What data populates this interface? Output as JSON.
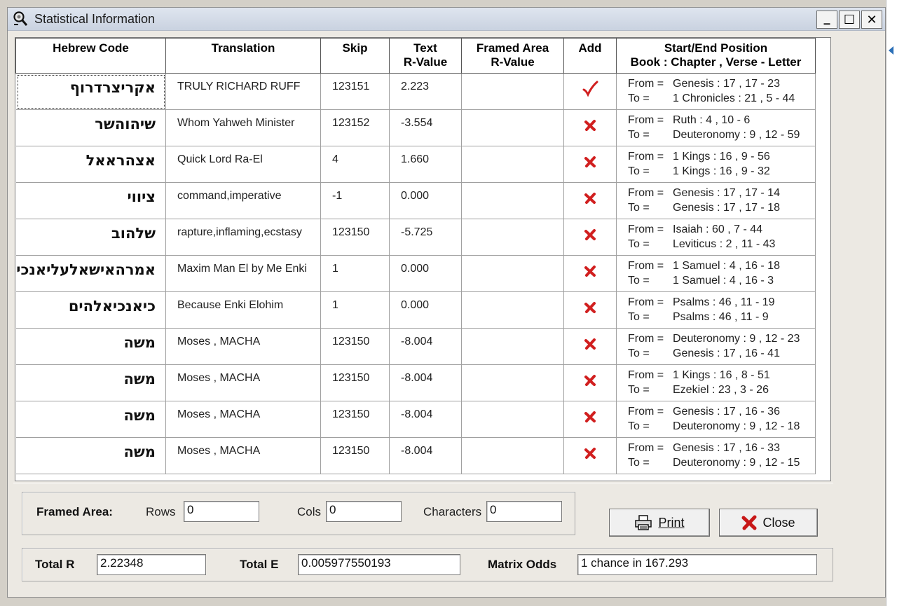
{
  "window": {
    "title": "Statistical Information",
    "min_glyph": "_",
    "max_glyph": "☐",
    "close_glyph": "✕"
  },
  "table": {
    "headers": {
      "hebrew_code": "Hebrew Code",
      "translation": "Translation",
      "skip": "Skip",
      "text_r_line1": "Text",
      "text_r_line2": "R-Value",
      "framed_line1": "Framed Area",
      "framed_line2": "R-Value",
      "add": "Add",
      "pos_line1": "Start/End Position",
      "pos_line2": "Book : Chapter , Verse - Letter"
    },
    "rows": [
      {
        "hebrew": "אקריצרדרוף",
        "translation": "TRULY RICHARD RUFF",
        "skip": "123151",
        "text_r": "2.223",
        "framed_r": "",
        "add": "check",
        "from": "Genesis : 17 , 17 - 23",
        "to": "1 Chronicles : 21 , 5 - 44"
      },
      {
        "hebrew": "שיהוהשר",
        "translation": "Whom Yahweh Minister",
        "skip": "123152",
        "text_r": "-3.554",
        "framed_r": "",
        "add": "x",
        "from": "Ruth : 4 , 10 - 6",
        "to": "Deuteronomy : 9 , 12 - 59"
      },
      {
        "hebrew": "אצהראאל",
        "translation": "Quick Lord Ra-El",
        "skip": "4",
        "text_r": "1.660",
        "framed_r": "",
        "add": "x",
        "from": "1 Kings : 16 , 9 - 56",
        "to": "1 Kings : 16 , 9 - 32"
      },
      {
        "hebrew": "ציווי",
        "translation": "command,imperative",
        "skip": "-1",
        "text_r": "0.000",
        "framed_r": "",
        "add": "x",
        "from": "Genesis : 17 , 17 - 14",
        "to": "Genesis : 17 , 17 - 18"
      },
      {
        "hebrew": "שלהוב",
        "translation": "rapture,inflaming,ecstasy",
        "skip": "123150",
        "text_r": "-5.725",
        "framed_r": "",
        "add": "x",
        "from": "Isaiah : 60 , 7 - 44",
        "to": "Leviticus : 2 , 11 - 43"
      },
      {
        "hebrew": "אמרהאישאלעליאנכי",
        "translation": "Maxim Man El by Me Enki",
        "skip": "1",
        "text_r": "0.000",
        "framed_r": "",
        "add": "x",
        "from": "1 Samuel : 4 , 16 - 18",
        "to": "1 Samuel : 4 , 16 - 3"
      },
      {
        "hebrew": "כיאנכיאלהים",
        "translation": "Because Enki Elohim",
        "skip": "1",
        "text_r": "0.000",
        "framed_r": "",
        "add": "x",
        "from": "Psalms : 46 , 11 - 19",
        "to": "Psalms : 46 , 11 - 9"
      },
      {
        "hebrew": "משה",
        "translation": "Moses , MACHA",
        "skip": "123150",
        "text_r": "-8.004",
        "framed_r": "",
        "add": "x",
        "from": "Deuteronomy : 9 , 12 - 23",
        "to": "Genesis : 17 , 16 - 41"
      },
      {
        "hebrew": "משה",
        "translation": "Moses , MACHA",
        "skip": "123150",
        "text_r": "-8.004",
        "framed_r": "",
        "add": "x",
        "from": "1 Kings : 16 , 8 - 51",
        "to": "Ezekiel : 23 , 3 - 26"
      },
      {
        "hebrew": "משה",
        "translation": "Moses , MACHA",
        "skip": "123150",
        "text_r": "-8.004",
        "framed_r": "",
        "add": "x",
        "from": "Genesis : 17 , 16 - 36",
        "to": "Deuteronomy : 9 , 12 - 18"
      },
      {
        "hebrew": "משה",
        "translation": "Moses , MACHA",
        "skip": "123150",
        "text_r": "-8.004",
        "framed_r": "",
        "add": "x",
        "from": "Genesis : 17 , 16 - 33",
        "to": "Deuteronomy : 9 , 12 - 15"
      }
    ],
    "from_label": "From =",
    "to_label": "To ="
  },
  "framed_area": {
    "label": "Framed Area:",
    "rows_label": "Rows",
    "rows_value": "0",
    "cols_label": "Cols",
    "cols_value": "0",
    "chars_label": "Characters",
    "chars_value": "0"
  },
  "buttons": {
    "print": "Print",
    "close": "Close"
  },
  "totals": {
    "total_r_label": "Total R",
    "total_r_value": "2.22348",
    "total_e_label": "Total  E",
    "total_e_value": "0.005977550193",
    "odds_label": "Matrix Odds",
    "odds_value": "1 chance in 167.293"
  },
  "colors": {
    "check": "#d11f1f",
    "x": "#d11f1f",
    "titlebar": "#cfd8e6"
  }
}
